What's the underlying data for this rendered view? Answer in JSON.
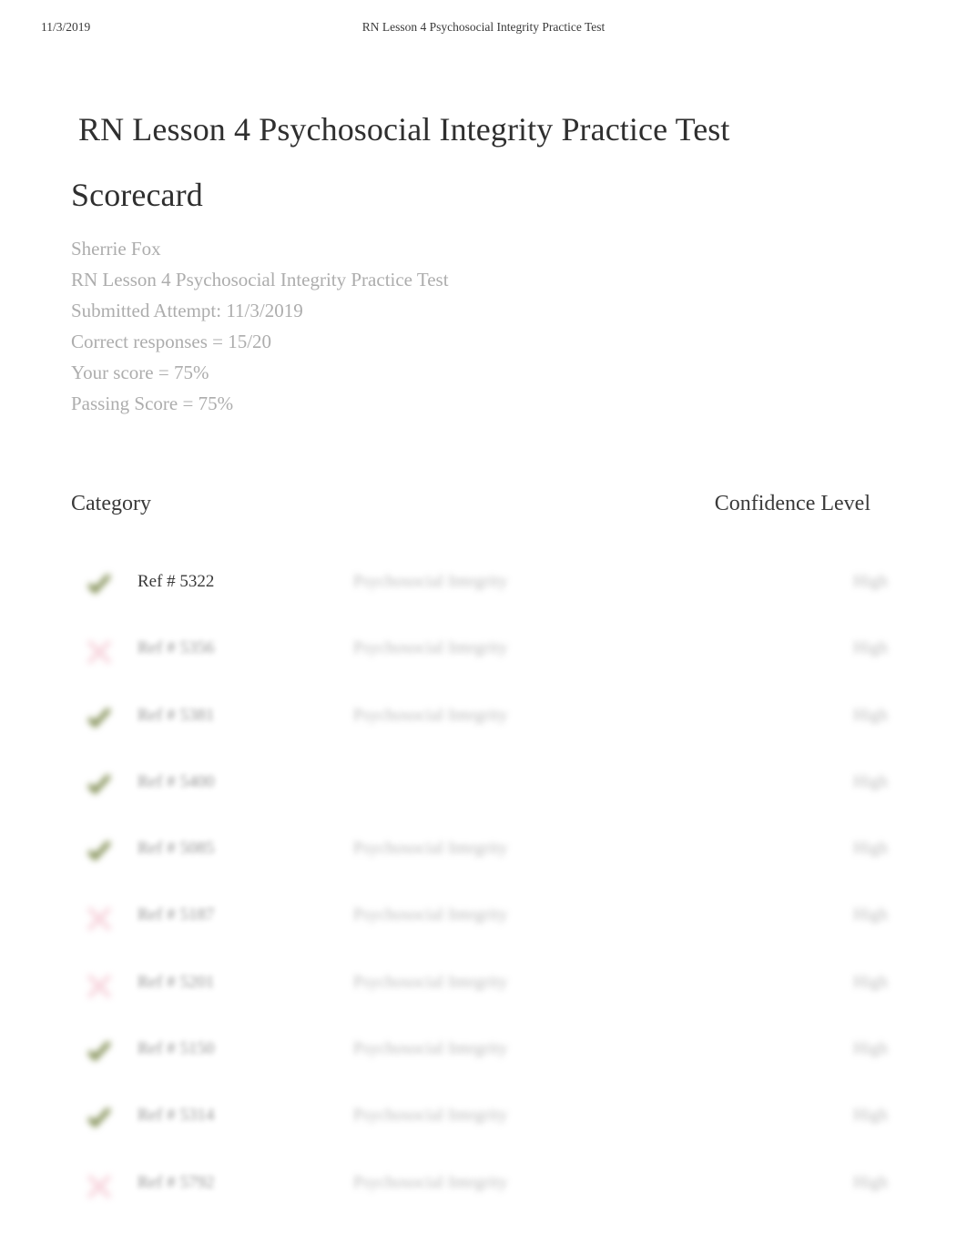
{
  "print_header": {
    "date": "11/3/2019",
    "title": "RN Lesson 4 Psychosocial Integrity Practice Test"
  },
  "document": {
    "title_line1": "RN Lesson 4 Psychosocial Integrity Practice Test",
    "title_line2": "Scorecard"
  },
  "meta": {
    "student_name": "Sherrie Fox",
    "test_name": "RN Lesson 4 Psychosocial Integrity Practice Test",
    "submitted_attempt": "Submitted Attempt: 11/3/2019",
    "correct_responses": "Correct responses = 15/20",
    "your_score": "Your score = 75%",
    "passing_score": "Passing Score = 75%"
  },
  "table": {
    "headers": {
      "category": "Category",
      "confidence": "Confidence Level"
    },
    "rows": [
      {
        "result": "correct",
        "icon": "check-icon",
        "ref": "Ref # 5322",
        "category": "Psychosocial Integrity",
        "confidence": "High",
        "clarity": "sharp"
      },
      {
        "result": "incorrect",
        "icon": "x-icon",
        "ref": "Ref # 5356",
        "category": "Psychosocial Integrity",
        "confidence": "High",
        "clarity": "blurred"
      },
      {
        "result": "correct",
        "icon": "check-icon",
        "ref": "Ref # 5381",
        "category": "Psychosocial Integrity",
        "confidence": "High",
        "clarity": "blurred"
      },
      {
        "result": "correct",
        "icon": "check-icon",
        "ref": "Ref # 5400",
        "category": "",
        "confidence": "High",
        "clarity": "blurred"
      },
      {
        "result": "correct",
        "icon": "check-icon",
        "ref": "Ref # 5085",
        "category": "Psychosocial Integrity",
        "confidence": "High",
        "clarity": "blurred"
      },
      {
        "result": "incorrect",
        "icon": "x-icon",
        "ref": "Ref # 5187",
        "category": "Psychosocial Integrity",
        "confidence": "High",
        "clarity": "blurred"
      },
      {
        "result": "incorrect",
        "icon": "x-icon",
        "ref": "Ref # 5201",
        "category": "Psychosocial Integrity",
        "confidence": "High",
        "clarity": "blurred"
      },
      {
        "result": "correct",
        "icon": "check-icon",
        "ref": "Ref # 5150",
        "category": "Psychosocial Integrity",
        "confidence": "High",
        "clarity": "blurred"
      },
      {
        "result": "correct",
        "icon": "check-icon",
        "ref": "Ref # 5314",
        "category": "Psychosocial Integrity",
        "confidence": "High",
        "clarity": "blurred"
      },
      {
        "result": "incorrect",
        "icon": "x-icon",
        "ref": "Ref # 5792",
        "category": "Psychosocial Integrity",
        "confidence": "High",
        "clarity": "blurred"
      }
    ]
  },
  "colors": {
    "correct_green": "#7d8a4e",
    "incorrect_pink": "#f1b6c4",
    "body_text": "#3a3a3a",
    "muted_text": "#adadad",
    "background": "#ffffff"
  }
}
